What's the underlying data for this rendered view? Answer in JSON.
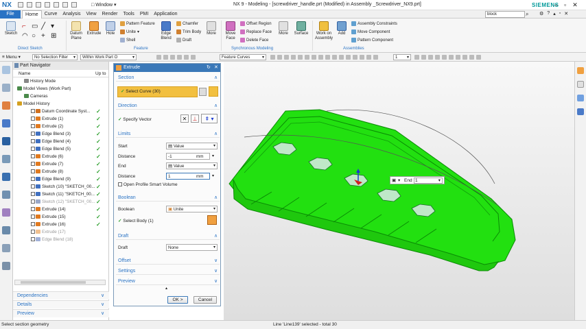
{
  "app": {
    "logo": "NX",
    "window_menu": "Window",
    "title": "NX 9 - Modeling - [screwdriver_handle.prt (Modified)  in Assembly _Screwdriver_NX9.prt]",
    "brand": "SIEMENS"
  },
  "menubar": {
    "file": "File",
    "tabs": [
      "Home",
      "Curve",
      "Analysis",
      "View",
      "Render",
      "Tools",
      "PMI",
      "Application"
    ],
    "search_value": "block"
  },
  "ribbon": {
    "direct_sketch": {
      "sketch": "Sketch",
      "label": "Direct Sketch"
    },
    "feature": {
      "datum_plane": "Datum Plane",
      "extrude": "Extrude",
      "hole": "Hole",
      "pattern_feature": "Pattern Feature",
      "unite": "Unite",
      "shell": "Shell",
      "edge_blend": "Edge Blend",
      "chamfer": "Chamfer",
      "trim_body": "Trim Body",
      "draft": "Draft",
      "more": "More",
      "label": "Feature"
    },
    "synchronous": {
      "move_face": "Move Face",
      "offset_region": "Offset Region",
      "replace_face": "Replace Face",
      "delete_face": "Delete Face",
      "more": "More",
      "label": "Synchronous Modeling"
    },
    "surface": "Surface",
    "assemblies": {
      "work_on_assembly": "Work on Assembly",
      "add": "Add",
      "assembly_constraints": "Assembly Constraints",
      "move_component": "Move Component",
      "pattern_component": "Pattern Component",
      "label": "Assemblies"
    }
  },
  "toolbar2": {
    "menu": "Menu",
    "selection_filter": "No Selection Filter",
    "scope": "Within Work Part O",
    "feature_curves": "Feature Curves",
    "count_value": "1"
  },
  "navigator": {
    "title": "Part Navigator",
    "col_name": "Name",
    "col_upto": "Up to",
    "items": [
      {
        "label": "History Mode",
        "level": 1,
        "check": false,
        "grey": false,
        "color": "#888888"
      },
      {
        "label": "Model Views (Work Part)",
        "level": 0,
        "check": false,
        "grey": false,
        "color": "#4a8a4a"
      },
      {
        "label": "Cameras",
        "level": 1,
        "check": false,
        "grey": false,
        "color": "#4a8a4a"
      },
      {
        "label": "Model History",
        "level": 0,
        "check": false,
        "grey": false,
        "color": "#d4a020"
      },
      {
        "label": "Datum Coordinate Syst...",
        "level": 2,
        "check": true,
        "grey": false,
        "color": "#d07020"
      },
      {
        "label": "Extrude (1)",
        "level": 2,
        "check": true,
        "grey": false,
        "color": "#e07a20"
      },
      {
        "label": "Extrude (2)",
        "level": 2,
        "check": true,
        "grey": false,
        "color": "#e07a20"
      },
      {
        "label": "Edge Blend (3)",
        "level": 2,
        "check": true,
        "grey": false,
        "color": "#4070c0"
      },
      {
        "label": "Edge Blend (4)",
        "level": 2,
        "check": true,
        "grey": false,
        "color": "#4070c0"
      },
      {
        "label": "Edge Blend (5)",
        "level": 2,
        "check": true,
        "grey": false,
        "color": "#4070c0"
      },
      {
        "label": "Extrude (6)",
        "level": 2,
        "check": true,
        "grey": false,
        "color": "#e07a20"
      },
      {
        "label": "Extrude (7)",
        "level": 2,
        "check": true,
        "grey": false,
        "color": "#e07a20"
      },
      {
        "label": "Extrude (8)",
        "level": 2,
        "check": true,
        "grey": false,
        "color": "#e07a20"
      },
      {
        "label": "Edge Blend (9)",
        "level": 2,
        "check": true,
        "grey": false,
        "color": "#4070c0"
      },
      {
        "label": "Sketch (10) \"SKETCH_00...",
        "level": 2,
        "check": true,
        "grey": false,
        "color": "#4070c0"
      },
      {
        "label": "Sketch (11) \"SKETCH_00...",
        "level": 2,
        "check": true,
        "grey": false,
        "color": "#4070c0"
      },
      {
        "label": "Sketch (12) \"SKETCH_00...",
        "level": 2,
        "check": true,
        "grey": true,
        "color": "#9aa8c8"
      },
      {
        "label": "Extrude (14)",
        "level": 2,
        "check": true,
        "grey": false,
        "color": "#e07a20"
      },
      {
        "label": "Extrude (15)",
        "level": 2,
        "check": true,
        "grey": false,
        "color": "#e07a20"
      },
      {
        "label": "Extrude (16)",
        "level": 2,
        "check": true,
        "grey": false,
        "color": "#e07a20"
      },
      {
        "label": "Extrude (17)",
        "level": 2,
        "check": false,
        "grey": true,
        "color": "#f0c090"
      },
      {
        "label": "Edge Blend (18)",
        "level": 2,
        "check": false,
        "grey": true,
        "color": "#a0b0d8"
      }
    ],
    "sections": [
      "Dependencies",
      "Details",
      "Preview"
    ]
  },
  "dialog": {
    "title": "Extrude",
    "section": {
      "header": "Section",
      "select_curve": "Select Curve (30)"
    },
    "direction": {
      "header": "Direction",
      "specify_vector": "Specify Vector"
    },
    "limits": {
      "header": "Limits",
      "start_label": "Start",
      "start_value": "Value",
      "distance_label": "Distance",
      "start_distance": "-1",
      "unit": "mm",
      "end_label": "End",
      "end_value": "Value",
      "end_distance_label": "Distance",
      "end_distance": "1",
      "open_profile": "Open Profile Smart Volume"
    },
    "boolean": {
      "header": "Boolean",
      "label": "Boolean",
      "value": "Unite",
      "select_body": "Select Body (1)"
    },
    "draft": {
      "header": "Draft",
      "label": "Draft",
      "value": "None"
    },
    "offset": "Offset",
    "settings": "Settings",
    "preview": "Preview",
    "ok": "OK",
    "ok_suffix": ">",
    "cancel": "Cancel"
  },
  "viewport": {
    "end_label": "End",
    "end_value": "1"
  },
  "status": {
    "left": "Select section geometry",
    "middle": "Line 'Line139' selected - total 30"
  }
}
